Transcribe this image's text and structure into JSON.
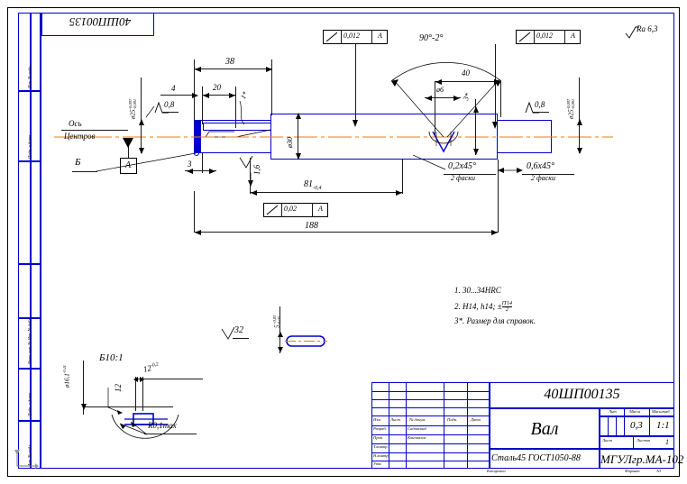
{
  "document": {
    "code_top_left": "40ШП00135",
    "surface_finish_corner": "Ra 6,3",
    "sheet_format": "А3",
    "copied_label": "Копировал",
    "format_label": "Формат"
  },
  "margin_labels": [
    "Инв. № подл.",
    "Подп. и дата",
    "Взам. инв. № Инв. № дубл.",
    "Подп. и дата",
    "Инв. № подл."
  ],
  "gdt_frames": [
    {
      "symbol": "total-runout",
      "tolerance": "0,012",
      "datum": "A"
    },
    {
      "symbol": "total-runout",
      "tolerance": "0,012",
      "datum": "A"
    },
    {
      "symbol": "total-runout",
      "tolerance": "0,02",
      "datum": "A"
    }
  ],
  "datum_label": "A",
  "axis_label_line1": "Ось",
  "axis_label_line2": "Центров",
  "main_view": {
    "dim_38": "38",
    "dim_4": "4",
    "dim_20": "20",
    "dim_3_left": "3",
    "dim_81": "81",
    "dim_81_tol": "-0,4",
    "dim_188": "188",
    "dim_40": "40",
    "dim_d6": "ø6",
    "dim_3_star": "3*",
    "dim_1_star": "1*",
    "angle_90": "90°-2°",
    "dia_left": "ø25",
    "dia_left_tol_up": "-0,007",
    "dia_left_tol_dn": "-0,081",
    "dia_right": "ø25",
    "dia_right_tol_up": "-0,007",
    "dia_right_tol_dn": "-0,081",
    "dia_mid": "ø30",
    "rough_08_left": "0,8",
    "rough_08_right": "0,8",
    "rough_16": "1,6",
    "letter_B": "Б",
    "chamfer_left": "0,2х45°",
    "chamfer_left_sub": "2 фаски",
    "chamfer_right": "0,6х45°",
    "chamfer_right_sub": "2 фаски"
  },
  "keyway_view": {
    "rough_32": "32",
    "dim_5": "5",
    "dim_5_tol_up": "+0,03",
    "dim_5_tol_dn": "-0,03"
  },
  "detail_view": {
    "title": "Б10:1",
    "dim_12_horiz": "12",
    "dim_12_tol": "-0,2",
    "dim_12_vert": "12",
    "radius_note": "R0,1max",
    "dia_vert": "ø16,1",
    "dia_vert_tol": "-0,11"
  },
  "technical_notes": [
    "1. 30...34HRC",
    "2. H14, h14;  ±IT14/2",
    "3*. Размер для справок."
  ],
  "title_block": {
    "drawing_number": "40ШП00135",
    "part_name": "Вал",
    "material": "Сталь45 ГОСТ1050-88",
    "organization": "МГУЛгр.МА-102",
    "header_lit": "Лит",
    "header_massa": "Масса",
    "header_masshtab": "Масштаб",
    "mass_value": "0,3",
    "scale_value": "1:1",
    "list_label": "Лист",
    "listov_label": "Листов",
    "listov_value": "1",
    "columns": [
      "Изм",
      "Лист",
      "№ докум.",
      "Подп.",
      "Дата"
    ],
    "rows": [
      {
        "role": "Разраб.",
        "name": "Садовский"
      },
      {
        "role": "Пров.",
        "name": "Коновалов"
      },
      {
        "role": "Т.контр.",
        "name": ""
      },
      {
        "role": "",
        "name": ""
      },
      {
        "role": "Н.контр.",
        "name": ""
      },
      {
        "role": "Утв.",
        "name": ""
      }
    ]
  },
  "colors": {
    "frame": "#0000cc",
    "part_outline": "#0000cc",
    "centerline": "#e08214",
    "dimension": "#1a1a1a"
  }
}
